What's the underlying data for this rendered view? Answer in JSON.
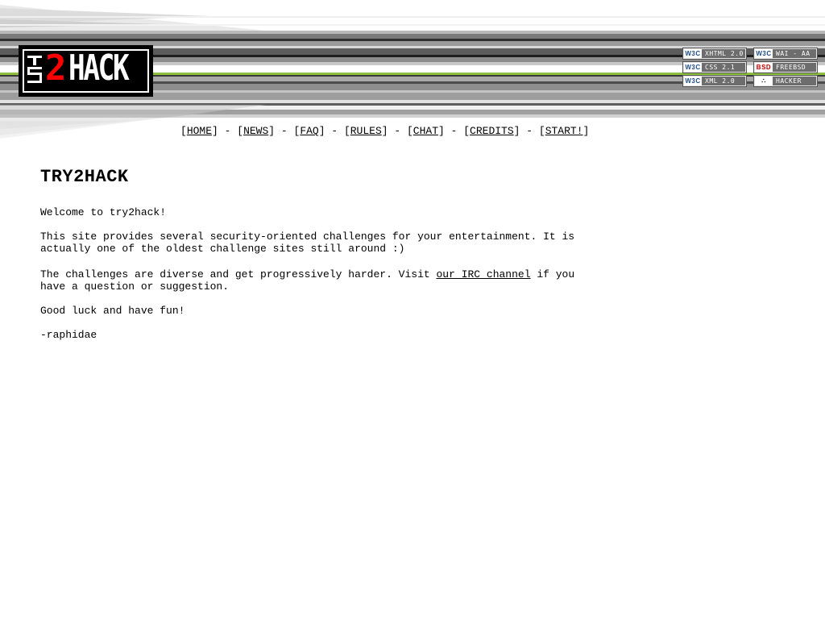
{
  "brand": {
    "logo_prefix": "try",
    "logo_number": "2",
    "logo_word": "HACK"
  },
  "badges": [
    {
      "tag": "W3C",
      "text": "XHTML 2.0"
    },
    {
      "tag": "W3C",
      "text": "WAI - AA"
    },
    {
      "tag": "W3C",
      "text": "CSS 2.1"
    },
    {
      "tag": "BSD",
      "text": "FREEBSD"
    },
    {
      "tag": "W3C",
      "text": "XML 2.0"
    },
    {
      "tag": "∴",
      "text": "HACKER"
    }
  ],
  "nav": {
    "items": [
      {
        "label": "HOME"
      },
      {
        "label": "NEWS"
      },
      {
        "label": "FAQ"
      },
      {
        "label": "RULES"
      },
      {
        "label": "CHAT"
      },
      {
        "label": "CREDITS"
      },
      {
        "label": "START!"
      }
    ],
    "open_bracket": "[",
    "close_bracket": "]",
    "separator": " - "
  },
  "content": {
    "title": "TRY2HACK",
    "welcome": "Welcome to try2hack!",
    "intro_line1": "This site provides several security-oriented challenges for your entertainment. It is",
    "intro_line2": "actually one of the oldest challenge sites still around :)",
    "challenges_before": "The challenges are diverse and get progressively harder. Visit ",
    "irc_link": "our IRC channel",
    "challenges_after": " if you",
    "challenges_line2": "have a question or suggestion.",
    "good_luck": "Good luck and have fun!",
    "signature": "-raphidae"
  },
  "colors": {
    "logo_accent": "#ff0000",
    "stripe_green": "#8dbf3c",
    "badge_bg": "#6d6d6d"
  }
}
